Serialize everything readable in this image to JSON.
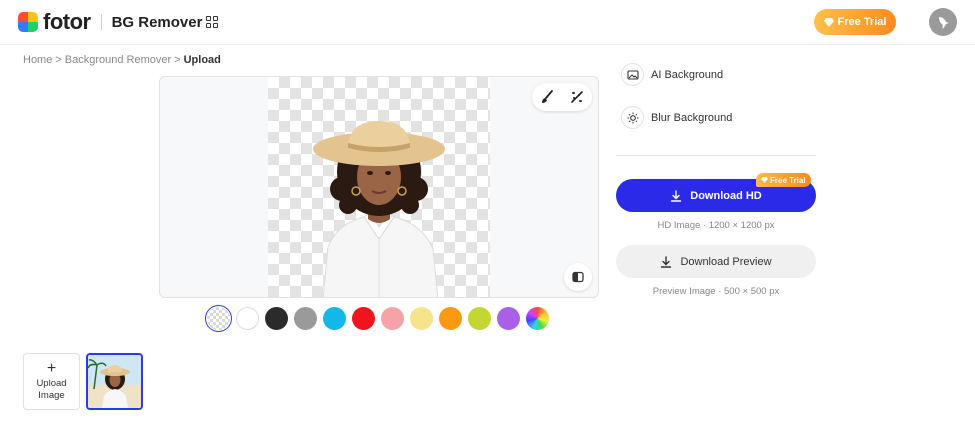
{
  "header": {
    "logo_text": "fotor",
    "product_name": "BG Remover",
    "free_trial_label": "Free Trial"
  },
  "breadcrumb": {
    "items": [
      "Home",
      "Background Remover",
      "Upload"
    ],
    "separator": ">"
  },
  "canvas": {
    "tools": [
      "brush-icon",
      "magic-wand-icon"
    ],
    "compare_icon": "compare-icon"
  },
  "swatches": [
    {
      "name": "transparent",
      "color": "checker"
    },
    {
      "name": "white",
      "color": "#ffffff"
    },
    {
      "name": "black",
      "color": "#2b2b2b"
    },
    {
      "name": "gray",
      "color": "#9a9a9a"
    },
    {
      "name": "cyan",
      "color": "#14b8e8"
    },
    {
      "name": "red",
      "color": "#f0141e"
    },
    {
      "name": "pink",
      "color": "#f5a3a8"
    },
    {
      "name": "yellow",
      "color": "#f7e38a"
    },
    {
      "name": "orange",
      "color": "#f99a12"
    },
    {
      "name": "lime",
      "color": "#c5d531"
    },
    {
      "name": "purple",
      "color": "#a960e8"
    },
    {
      "name": "rainbow",
      "color": "gradient"
    }
  ],
  "thumbnails": {
    "upload_label_line1": "Upload",
    "upload_label_line2": "Image"
  },
  "panel": {
    "ai_background_label": "AI Background",
    "blur_background_label": "Blur Background",
    "download_hd_label": "Download HD",
    "download_hd_badge": "Free Trial",
    "hd_caption": "HD Image · 1200 × 1200 px",
    "download_preview_label": "Download Preview",
    "preview_caption": "Preview Image · 500 × 500 px"
  },
  "colors": {
    "accent": "#2a2ae8",
    "trial_gradient_start": "#ffc04a",
    "trial_gradient_end": "#ff8a1e"
  }
}
